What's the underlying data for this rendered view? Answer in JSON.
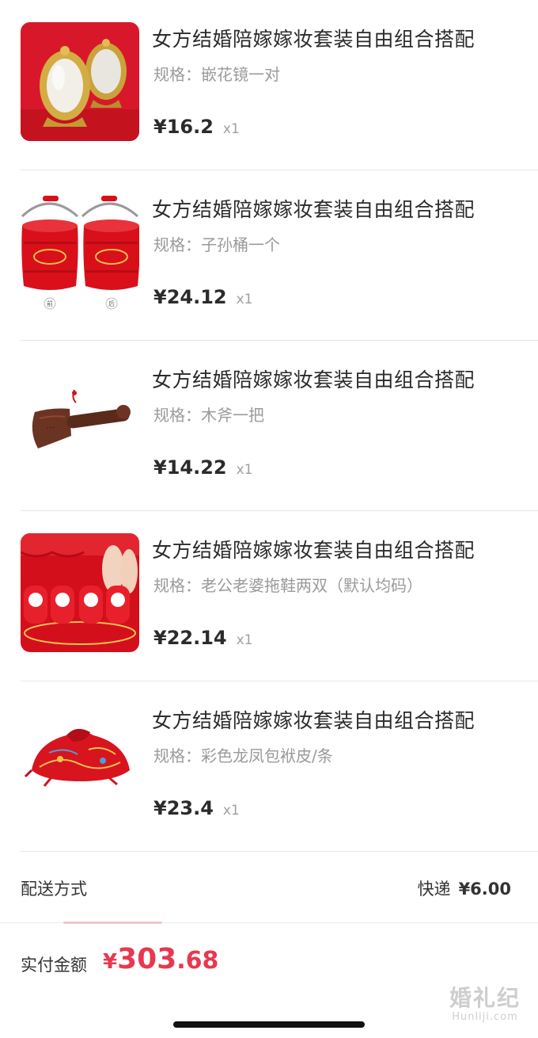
{
  "items": [
    {
      "title": "女方结婚陪嫁嫁妆套装自由组合搭配",
      "spec": "规格：嵌花镜一对",
      "price": "¥16.2",
      "qty": "x1",
      "image_icon": "mirror-pair-image"
    },
    {
      "title": "女方结婚陪嫁嫁妆套装自由组合搭配",
      "spec": "规格：子孙桶一个",
      "price": "¥24.12",
      "qty": "x1",
      "image_icon": "bucket-image",
      "image_captions": [
        "前",
        "后"
      ]
    },
    {
      "title": "女方结婚陪嫁嫁妆套装自由组合搭配",
      "spec": "规格：木斧一把",
      "price": "¥14.22",
      "qty": "x1",
      "image_icon": "wooden-axe-image"
    },
    {
      "title": "女方结婚陪嫁嫁妆套装自由组合搭配",
      "spec": "规格：老公老婆拖鞋两双（默认均码）",
      "price": "¥22.14",
      "qty": "x1",
      "image_icon": "slippers-image"
    },
    {
      "title": "女方结婚陪嫁嫁妆套装自由组合搭配",
      "spec": "规格：彩色龙凤包袱皮/条",
      "price": "¥23.4",
      "qty": "x1",
      "image_icon": "bundle-cloth-image"
    }
  ],
  "delivery": {
    "label": "配送方式",
    "method": "快递",
    "amount": "¥6.00"
  },
  "payment": {
    "label": "实付金额",
    "currency": "¥",
    "integer": "303",
    "decimal": ".68"
  },
  "watermark": {
    "main": "婚礼纪",
    "sub": "Hunliji.com"
  },
  "colors": {
    "accent_red": "#e8384f",
    "product_red": "#d9101a",
    "gold": "#c9a23a"
  }
}
